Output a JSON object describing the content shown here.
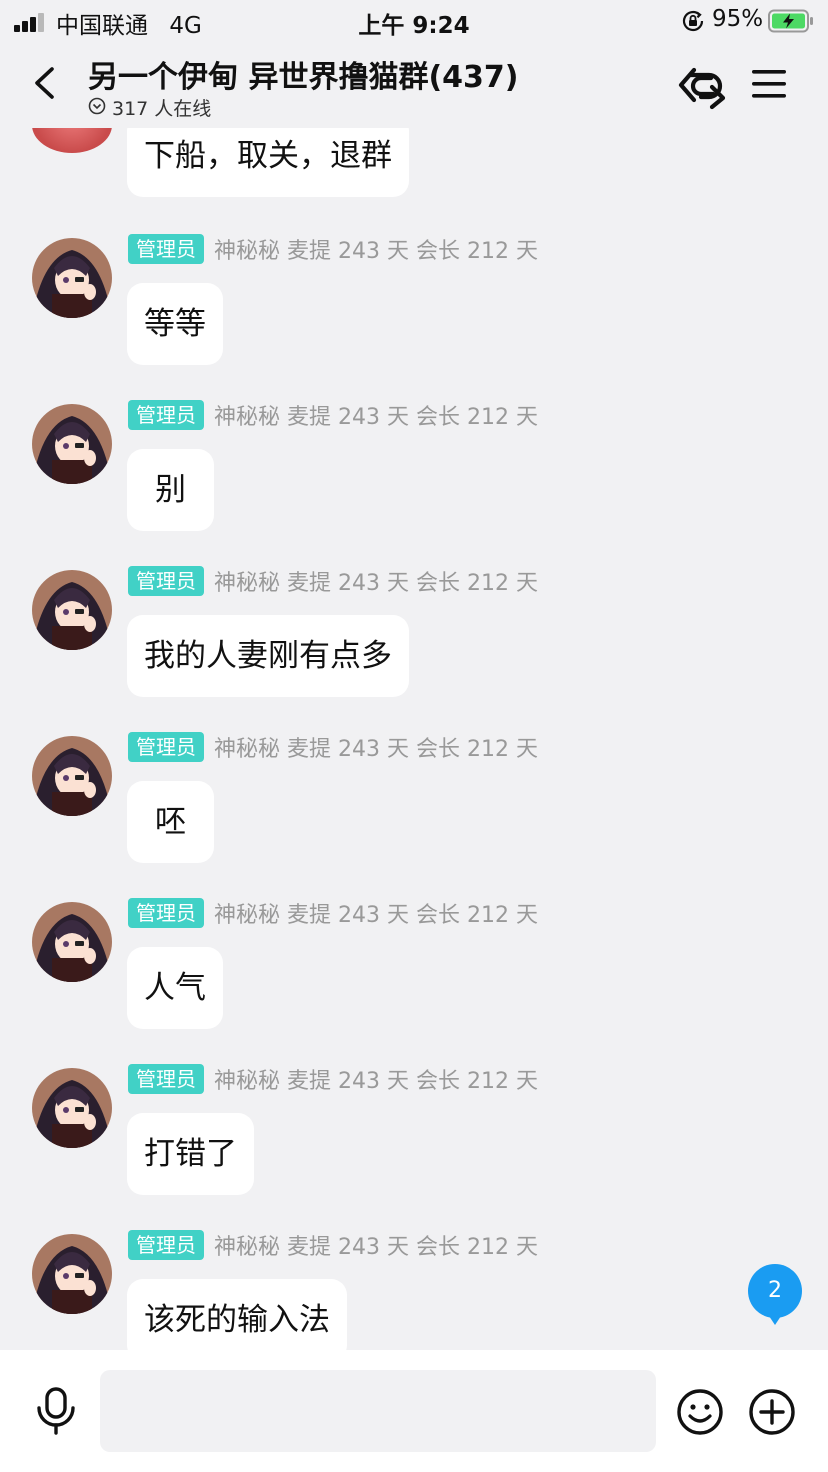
{
  "status_bar": {
    "carrier": "中国联通",
    "network": "4G",
    "time": "上午 9:24",
    "battery": "95%"
  },
  "header": {
    "title": "另一个伊甸 异世界撸猫群(437)",
    "online": "317 人在线"
  },
  "messages": [
    {
      "role": "",
      "meta": "",
      "text": "下船，取关，退群"
    },
    {
      "role": "管理员",
      "meta": "神秘秘 麦提 243 天 会长 212 天",
      "text": "等等"
    },
    {
      "role": "管理员",
      "meta": "神秘秘 麦提 243 天 会长 212 天",
      "text": "别"
    },
    {
      "role": "管理员",
      "meta": "神秘秘 麦提 243 天 会长 212 天",
      "text": "我的人妻刚有点多"
    },
    {
      "role": "管理员",
      "meta": "神秘秘 麦提 243 天 会长 212 天",
      "text": "呸"
    },
    {
      "role": "管理员",
      "meta": "神秘秘 麦提 243 天 会长 212 天",
      "text": "人气"
    },
    {
      "role": "管理员",
      "meta": "神秘秘 麦提 243 天 会长 212 天",
      "text": "打错了"
    },
    {
      "role": "管理员",
      "meta": "神秘秘 麦提 243 天 会长 212 天",
      "text": "该死的输入法"
    }
  ],
  "unread_count": "2",
  "input": {
    "value": "",
    "placeholder": ""
  },
  "icons": {
    "back": "chevron-left-icon",
    "link": "link-icon",
    "menu": "menu-icon",
    "mic": "microphone-icon",
    "emoji": "smiley-icon",
    "plus": "plus-circle-icon"
  },
  "colors": {
    "admin_badge": "#41d1c6",
    "unread_badge": "#1a9cf2",
    "background": "#f1f1f3"
  }
}
